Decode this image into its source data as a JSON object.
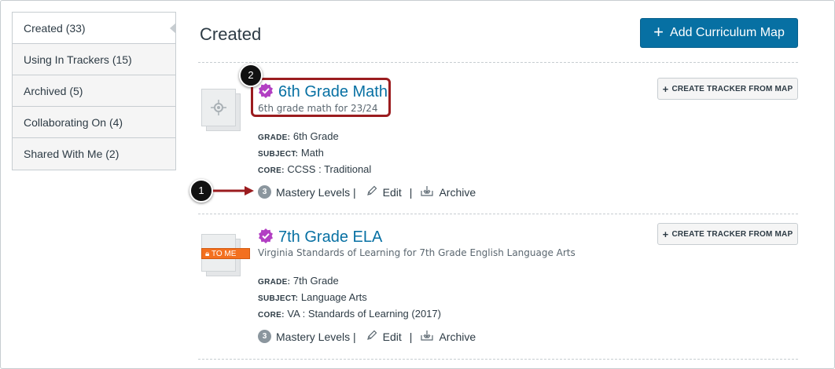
{
  "sidebar": {
    "items": [
      {
        "label": "Created (33)",
        "active": true
      },
      {
        "label": "Using In Trackers (15)",
        "active": false
      },
      {
        "label": "Archived (5)",
        "active": false
      },
      {
        "label": "Collaborating On (4)",
        "active": false
      },
      {
        "label": "Shared With Me (2)",
        "active": false
      }
    ]
  },
  "header": {
    "title": "Created",
    "add_button_label": "Add Curriculum Map"
  },
  "cards": [
    {
      "title": "6th Grade Math",
      "description": "6th grade math for 23/24",
      "grade_key": "GRADE:",
      "grade": "6th Grade",
      "subject_key": "SUBJECT:",
      "subject": "Math",
      "core_key": "CORE:",
      "core": "CCSS : Traditional",
      "mastery_count": "3",
      "mastery_label": "Mastery Levels |",
      "edit_label": "Edit",
      "archive_label": "Archive",
      "tracker_button": "CREATE TRACKER FROM MAP",
      "badge": ""
    },
    {
      "title": "7th Grade ELA",
      "description": "Virginia Standards of Learning for 7th Grade English Language Arts",
      "grade_key": "GRADE:",
      "grade": "7th Grade",
      "subject_key": "SUBJECT:",
      "subject": "Language Arts",
      "core_key": "CORE:",
      "core": "VA : Standards of Learning (2017)",
      "mastery_count": "3",
      "mastery_label": "Mastery Levels |",
      "edit_label": "Edit",
      "archive_label": "Archive",
      "tracker_button": "CREATE TRACKER FROM MAP",
      "badge": "TO ME"
    }
  ],
  "annotations": {
    "callout_1": "1",
    "callout_2": "2"
  },
  "colors": {
    "primary": "#0770a3",
    "verified_badge": "#b23fc3",
    "annotation_red": "#9b1c1f",
    "to_me_badge": "#f3701f"
  }
}
